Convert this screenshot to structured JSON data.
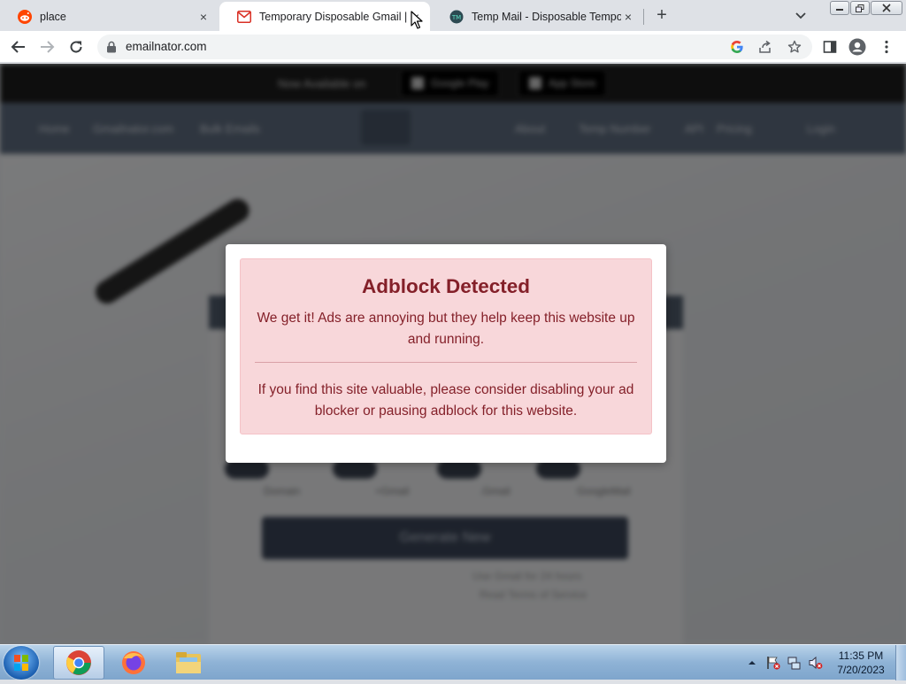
{
  "browser": {
    "tabs": [
      {
        "title": "place",
        "favicon": "reddit-icon"
      },
      {
        "title": "Temporary Disposable Gmail | Te",
        "favicon": "gmail-icon",
        "active": true
      },
      {
        "title": "Temp Mail - Disposable Tempora",
        "favicon": "tempmail-icon"
      }
    ],
    "url": "emailnator.com",
    "new_tab_label": "+",
    "close_glyph": "×"
  },
  "page": {
    "promo_text": "Now Available on",
    "store_google": "Google Play",
    "store_apple": "App Store",
    "nav_left": [
      "Home",
      "Gmailnator.com",
      "Bulk Emails"
    ],
    "nav_right": [
      "About",
      "Temp Number",
      "API",
      "Pricing",
      "Login"
    ],
    "radio_labels": [
      "Domain",
      "+Gmail",
      ".Gmail",
      "GoogleMail"
    ],
    "generate_label": "Generate New",
    "note1": "Use Gmail for 24 hours",
    "note2": "Read Terms of Service"
  },
  "modal": {
    "title": "Adblock Detected",
    "paragraph1": "We get it! Ads are annoying but they help keep this website up and running.",
    "paragraph2": "If you find this site valuable, please consider disabling your ad blocker or pausing adblock for this website.",
    "alert_bg": "#f8d7da",
    "alert_text": "#842029"
  },
  "taskbar": {
    "apps": [
      "chrome-icon",
      "firefox-icon",
      "file-explorer-icon"
    ],
    "time": "11:35 PM",
    "date": "7/20/2023"
  }
}
